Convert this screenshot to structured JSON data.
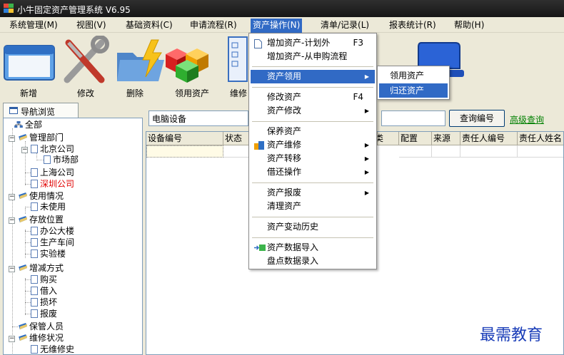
{
  "window": {
    "title": "小牛固定资产管理系统 V6.95"
  },
  "menubar": {
    "items": [
      {
        "label": "系统管理(M)"
      },
      {
        "label": "视图(V)"
      },
      {
        "label": "基础资料(C)"
      },
      {
        "label": "申请流程(R)"
      },
      {
        "label": "资产操作(N)"
      },
      {
        "label": "清单/记录(L)"
      },
      {
        "label": "报表统计(R)"
      },
      {
        "label": "帮助(H)"
      }
    ],
    "active_index": 4
  },
  "toolbar": {
    "buttons": [
      {
        "label": "新增",
        "icon": "window-icon"
      },
      {
        "label": "修改",
        "icon": "tools-icon"
      },
      {
        "label": "删除",
        "icon": "folder-lightning-icon"
      },
      {
        "label": "领用资产",
        "icon": "cubes-icon"
      },
      {
        "label": "维修",
        "icon": "document-icon"
      },
      {
        "label": "",
        "icon": "monitor-icon"
      }
    ]
  },
  "nav_tab": {
    "label": "导航浏览"
  },
  "tree": {
    "nodes": [
      {
        "label": "全部",
        "icon": "network-icon"
      },
      {
        "label": "管理部门",
        "icon": "folder-icon"
      },
      {
        "label": "北京公司",
        "icon": "doc-icon"
      },
      {
        "label": "市场部",
        "icon": "doc-icon"
      },
      {
        "label": "上海公司",
        "icon": "doc-icon"
      },
      {
        "label": "深圳公司",
        "icon": "doc-icon",
        "selected": true
      },
      {
        "label": "使用情况",
        "icon": "folder-icon"
      },
      {
        "label": "未使用",
        "icon": "doc-icon"
      },
      {
        "label": "存放位置",
        "icon": "folder-icon"
      },
      {
        "label": "办公大楼",
        "icon": "doc-icon"
      },
      {
        "label": "生产车间",
        "icon": "doc-icon"
      },
      {
        "label": "实验楼",
        "icon": "doc-icon"
      },
      {
        "label": "增减方式",
        "icon": "folder-icon"
      },
      {
        "label": "购买",
        "icon": "doc-icon"
      },
      {
        "label": "借入",
        "icon": "doc-icon"
      },
      {
        "label": "损坏",
        "icon": "doc-icon"
      },
      {
        "label": "报废",
        "icon": "doc-icon"
      },
      {
        "label": "保管人员",
        "icon": "folder-icon"
      },
      {
        "label": "维修状况",
        "icon": "folder-icon"
      },
      {
        "label": "无维修史",
        "icon": "doc-icon"
      }
    ]
  },
  "search": {
    "category": "电脑设备",
    "query_button": "查询编号",
    "advanced_link": "高级查询"
  },
  "grid": {
    "columns": [
      "设备编号",
      "状态",
      "",
      "",
      "类",
      "配置",
      "来源",
      "责任人编号",
      "责任人姓名"
    ]
  },
  "op_menu": {
    "items": [
      {
        "label": "增加资产-计划外",
        "shortcut": "F3",
        "icon": "page-icon"
      },
      {
        "label": "增加资产-从申购流程"
      },
      {
        "label": "资产领用",
        "submenu": true,
        "active": true
      },
      {
        "label": "修改资产",
        "shortcut": "F4"
      },
      {
        "label": "资产修改",
        "submenu": true
      },
      {
        "label": "保养资产"
      },
      {
        "label": "资产维修",
        "submenu": true,
        "icon": "repair-icon"
      },
      {
        "label": "资产转移",
        "submenu": true
      },
      {
        "label": "借还操作",
        "submenu": true
      },
      {
        "label": "资产报废",
        "submenu": true
      },
      {
        "label": "清理资产"
      },
      {
        "label": "资产变动历史"
      },
      {
        "label": "资产数据导入",
        "icon": "import-icon"
      },
      {
        "label": "盘点数据录入"
      }
    ]
  },
  "sub_menu": {
    "items": [
      {
        "label": "领用资产"
      },
      {
        "label": "归还资产",
        "active": true
      }
    ]
  },
  "watermark": "最需教育",
  "colors": {
    "highlight": "#316ac5",
    "selected_text": "#e00000",
    "link": "#008000",
    "watermark": "#1a3db8"
  }
}
